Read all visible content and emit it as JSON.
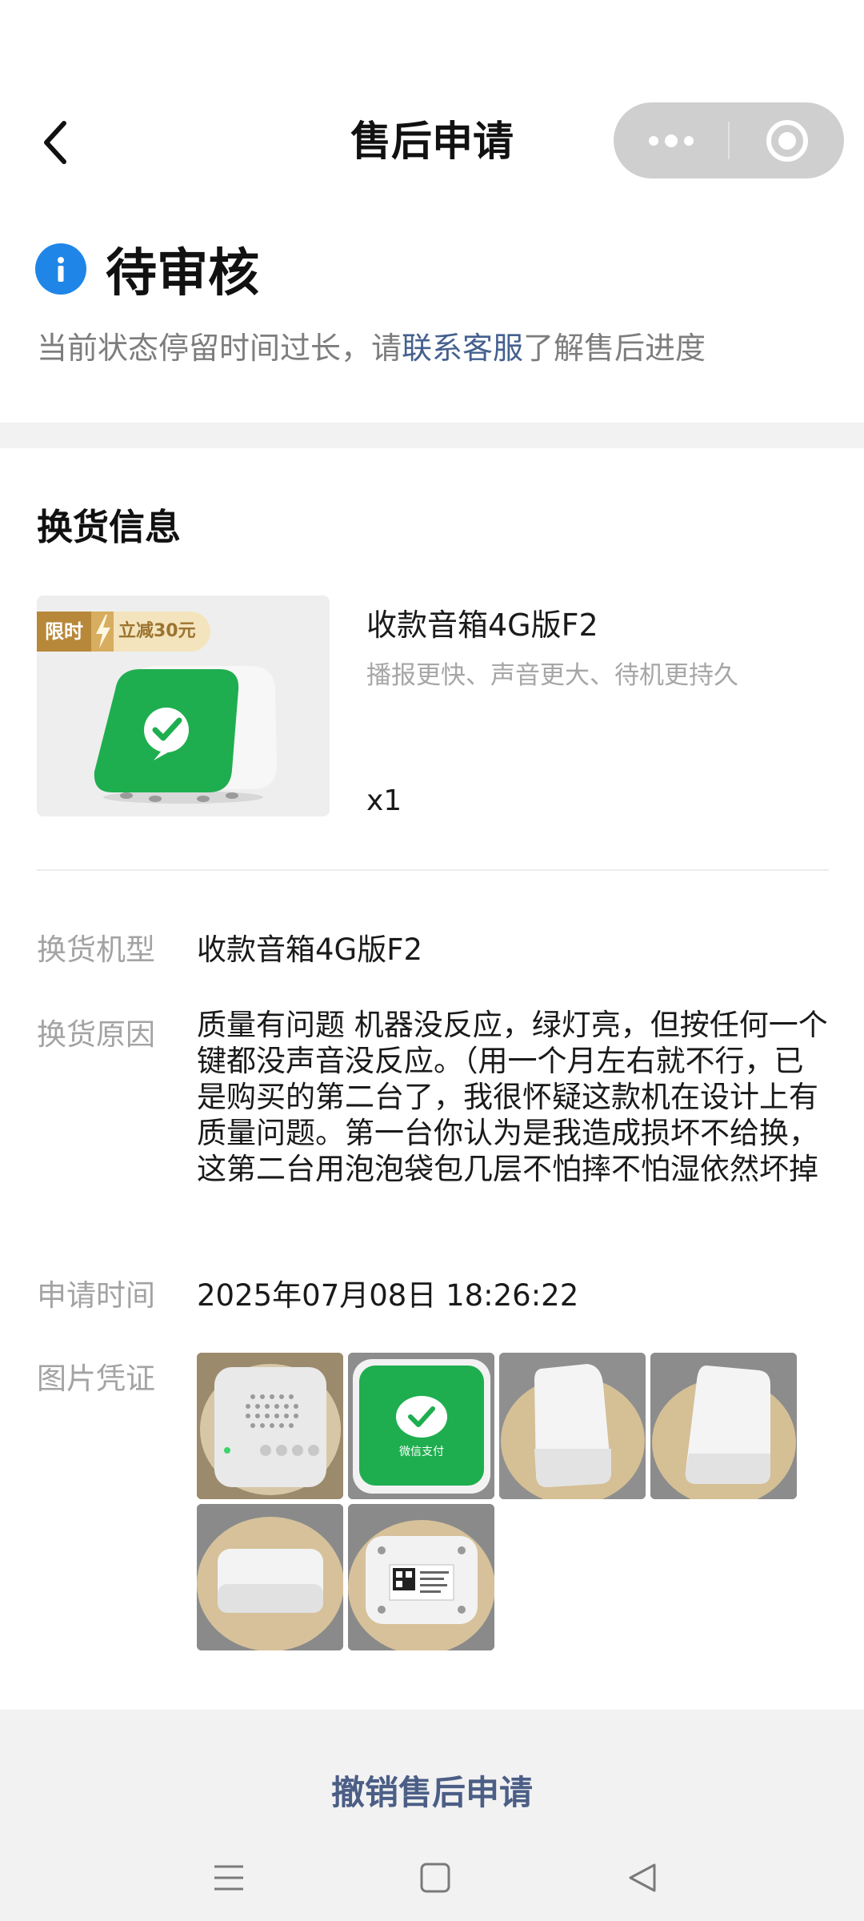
{
  "navbar": {
    "title": "售后申请",
    "back_icon": "chevron-left-icon",
    "more_icon": "more-dots-icon",
    "close_icon": "target-close-icon"
  },
  "status": {
    "title": "待审核",
    "desc_prefix": "当前状态停留时间过长，请",
    "desc_link": "联系客服",
    "desc_suffix": "了解售后进度",
    "icon": "info-icon",
    "icon_color": "#1f86e8"
  },
  "exchange": {
    "heading": "换货信息",
    "product": {
      "promo_label": "限时",
      "promo_text": "立减30元",
      "name": "收款音箱4G版F2",
      "subtitle": "播报更快、声音更大、待机更持久",
      "quantity": "x1"
    },
    "details": [
      {
        "label": "换货机型",
        "value": "收款音箱4G版F2"
      },
      {
        "label": "换货原因",
        "value": "质量有问题 机器没反应，绿灯亮，但按任何一个键都没声音没反应。（用一个月左右就不行，已是购买的第二台了，我很怀疑这款机在设计上有质量问题。第一台你认为是我造成损坏不给换，这第二台用泡泡袋包几层不怕摔不怕湿依然坏掉"
      },
      {
        "label": "申请时间",
        "value": "2025年07月08日 18:26:22"
      },
      {
        "label": "图片凭证",
        "value": ""
      }
    ],
    "photo_overlay_text": "微信支付",
    "photos": [
      "speaker-top-photo",
      "wechat-pay-logo-photo",
      "device-side-photo",
      "device-side-photo-2",
      "device-bottom-photo",
      "device-label-photo"
    ]
  },
  "footer": {
    "cancel_label": "撤销售后申请",
    "sys_nav": [
      "menu-icon",
      "home-square-icon",
      "back-triangle-icon"
    ]
  },
  "colors": {
    "accent_link": "#45608f",
    "cancel_text": "#4b5e86",
    "brand_green": "#1fae4f"
  }
}
